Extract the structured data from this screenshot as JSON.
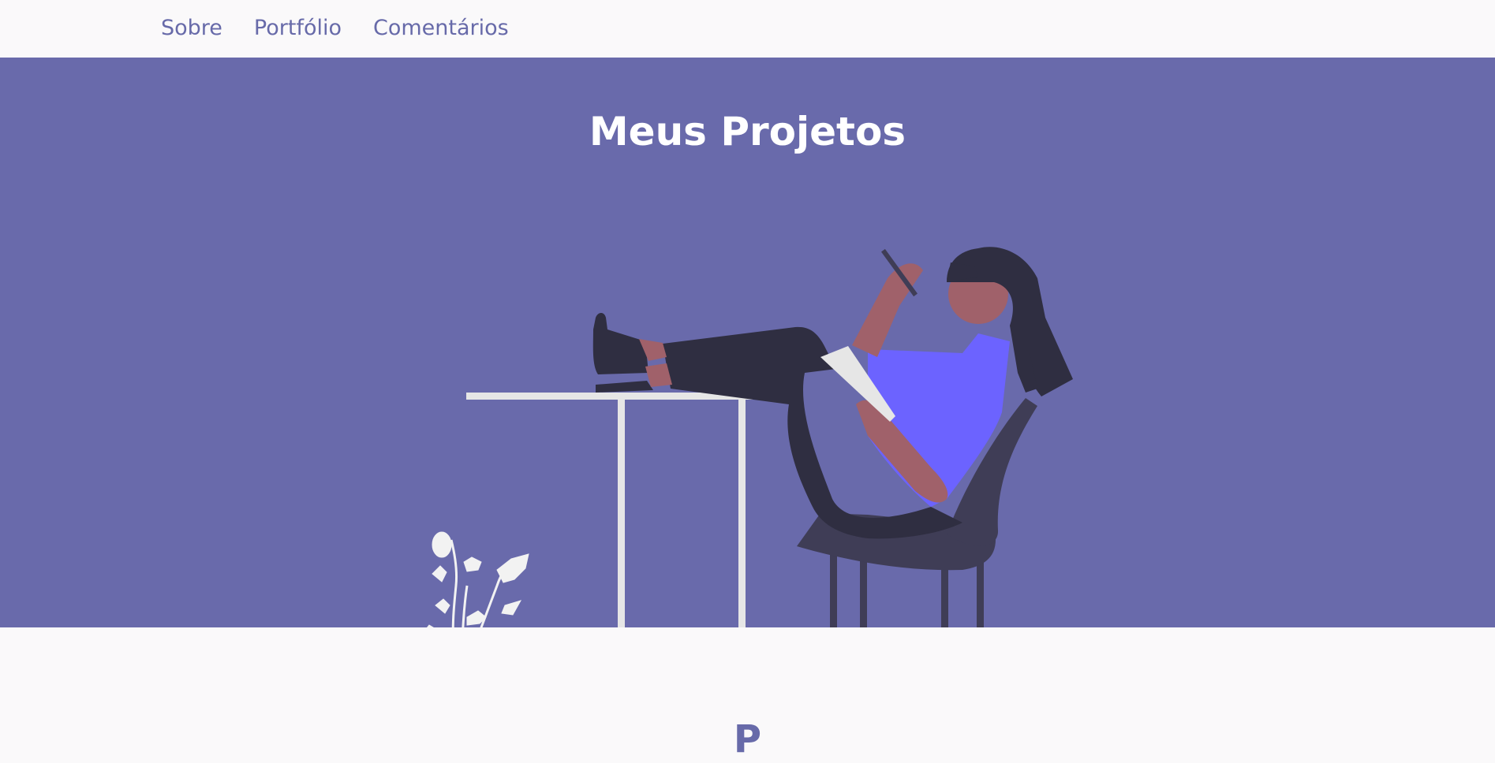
{
  "nav": {
    "items": [
      {
        "label": "Sobre"
      },
      {
        "label": "Portfólio"
      },
      {
        "label": "Comentários"
      }
    ]
  },
  "hero": {
    "title": "Meus Projetos"
  },
  "next_section": {
    "heading": "P"
  },
  "colors": {
    "brand": "#696aab",
    "nav_text": "#676aa9",
    "page_bg": "#faf9fa",
    "shirt": "#6c63ff",
    "skin": "#a0616a",
    "hair": "#2f2e41",
    "chair": "#3f3d56",
    "furniture": "#e6e6e6",
    "plant": "#f2f2f2"
  }
}
